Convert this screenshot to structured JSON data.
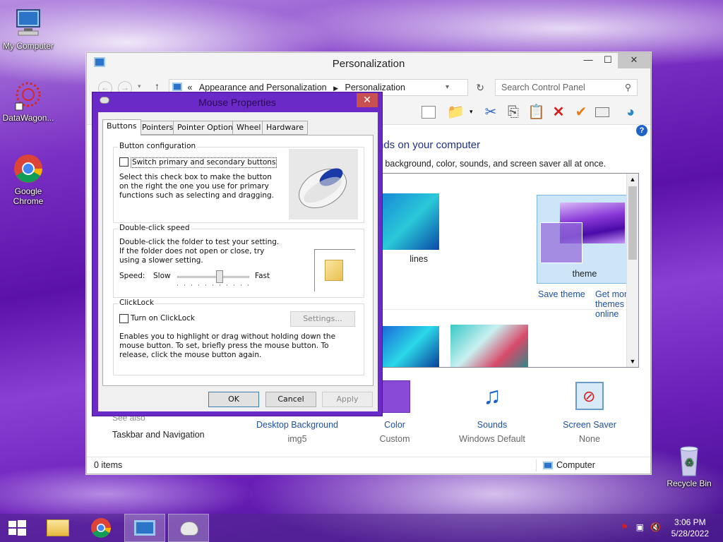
{
  "desktop": {
    "icons": [
      {
        "label": "My Computer"
      },
      {
        "label": "DataWagon..."
      },
      {
        "label": "Google Chrome"
      },
      {
        "label": "Recycle Bin"
      }
    ]
  },
  "personalization": {
    "title": "Personalization",
    "breadcrumb": {
      "prefix": "«",
      "items": [
        "Appearance and Personalization",
        "Personalization"
      ]
    },
    "search_placeholder": "Search Control Panel",
    "heading": "nds on your computer",
    "subheading": "o background, color, sounds, and screen saver all at once.",
    "themes": [
      {
        "name": "lines"
      },
      {
        "name": "theme"
      }
    ],
    "save_theme": "Save theme",
    "get_more_themes": "Get more themes online",
    "see_also_label": "See also",
    "see_also_links": [
      "Taskbar and Navigation"
    ],
    "bottom_items": [
      {
        "label": "Desktop Background",
        "value": "img5"
      },
      {
        "label": "Color",
        "value": "Custom"
      },
      {
        "label": "Sounds",
        "value": "Windows Default"
      },
      {
        "label": "Screen Saver",
        "value": "None"
      }
    ],
    "status": {
      "items": "0 items",
      "location": "Computer"
    }
  },
  "mouse_properties": {
    "title": "Mouse Properties",
    "tabs": [
      "Buttons",
      "Pointers",
      "Pointer Options",
      "Wheel",
      "Hardware"
    ],
    "active_tab": "Buttons",
    "button_config": {
      "group_label": "Button configuration",
      "checkbox_label": "Switch primary and secondary buttons",
      "checked": false,
      "description": "Select this check box to make the button on the right the one you use for primary functions such as selecting and dragging."
    },
    "double_click": {
      "group_label": "Double-click speed",
      "description": "Double-click the folder to test your setting. If the folder does not open or close, try using a slower setting.",
      "speed_label": "Speed:",
      "slow_label": "Slow",
      "fast_label": "Fast",
      "speed_fraction": 0.6
    },
    "clicklock": {
      "group_label": "ClickLock",
      "checkbox_label": "Turn on ClickLock",
      "checked": false,
      "settings_button": "Settings...",
      "description": "Enables you to highlight or drag without holding down the mouse button. To set, briefly press the mouse button. To release, click the mouse button again."
    },
    "buttons": {
      "ok": "OK",
      "cancel": "Cancel",
      "apply": "Apply"
    }
  },
  "taskbar": {
    "time": "3:06 PM",
    "date": "5/28/2022"
  }
}
